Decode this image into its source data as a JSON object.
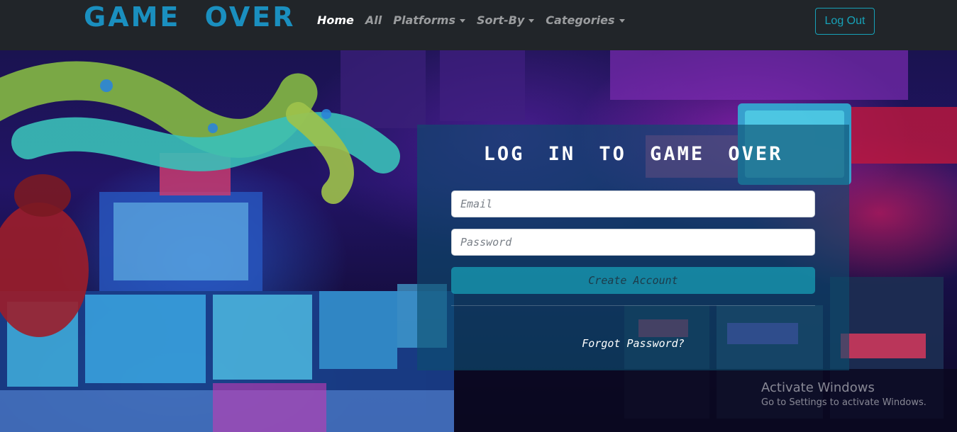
{
  "brand": {
    "text": "GAME OVER",
    "color": "#1a8fbf"
  },
  "nav": {
    "home": "Home",
    "all": "All",
    "platforms": "Platforms",
    "sort_by": "Sort-By",
    "categories": "Categories",
    "active": "Home"
  },
  "header": {
    "logout_label": "Log Out",
    "accent": "#17a2b8"
  },
  "login": {
    "title": "LOG IN TO GAME OVER",
    "email_placeholder": "Email",
    "password_placeholder": "Password",
    "create_account_label": "Create Account",
    "forgot_password_label": "Forgot Password?"
  },
  "watermark": {
    "title": "Activate Windows",
    "subtitle": "Go to Settings to activate Windows."
  },
  "background": {
    "description_icon": "arcade-photo"
  },
  "icons": {
    "dropdown": "caret-down-icon"
  }
}
